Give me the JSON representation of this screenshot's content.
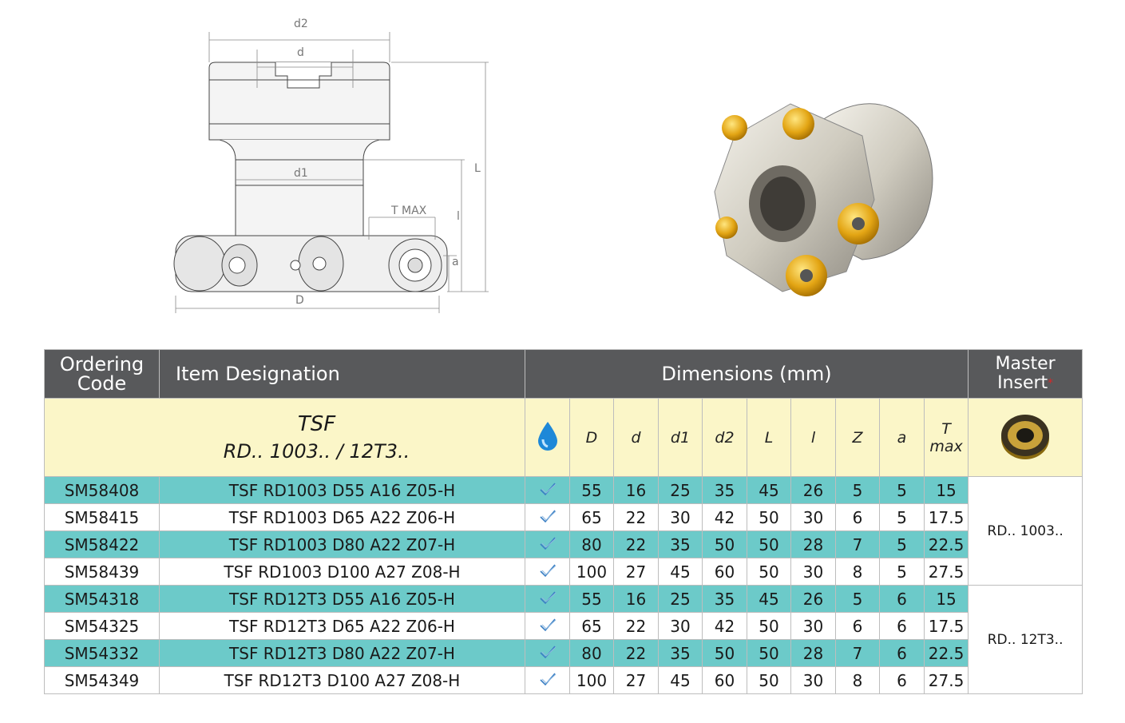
{
  "drawing": {
    "labels": {
      "d2": "d2",
      "d": "d",
      "d1": "d1",
      "tmax": "T MAX",
      "L": "L",
      "l": "l",
      "a": "a",
      "D": "D"
    }
  },
  "table": {
    "headers": {
      "ordering_code": [
        "Ordering",
        "Code"
      ],
      "item_designation": "Item Designation",
      "dimensions": "Dimensions (mm)",
      "master_insert": [
        "Master",
        "Insert"
      ],
      "master_mark": "*"
    },
    "series": {
      "name": "TSF",
      "inserts": "RD.. 1003.. / 12T3.."
    },
    "columns": [
      "D",
      "d",
      "d1",
      "d2",
      "L",
      "l",
      "Z",
      "a",
      "T",
      "max"
    ],
    "groups": [
      {
        "master": "RD.. 1003..",
        "rows": [
          {
            "code": "SM58408",
            "item": "TSF RD1003 D55 A16 Z05-H",
            "v": [
              "55",
              "16",
              "25",
              "35",
              "45",
              "26",
              "5",
              "5",
              "15"
            ]
          },
          {
            "code": "SM58415",
            "item": "TSF RD1003 D65 A22 Z06-H",
            "v": [
              "65",
              "22",
              "30",
              "42",
              "50",
              "30",
              "6",
              "5",
              "17.5"
            ]
          },
          {
            "code": "SM58422",
            "item": "TSF RD1003 D80 A22 Z07-H",
            "v": [
              "80",
              "22",
              "35",
              "50",
              "50",
              "28",
              "7",
              "5",
              "22.5"
            ]
          },
          {
            "code": "SM58439",
            "item": "TSF RD1003 D100 A27 Z08-H",
            "v": [
              "100",
              "27",
              "45",
              "60",
              "50",
              "30",
              "8",
              "5",
              "27.5"
            ]
          }
        ]
      },
      {
        "master": "RD.. 12T3..",
        "rows": [
          {
            "code": "SM54318",
            "item": "TSF RD12T3 D55 A16 Z05-H",
            "v": [
              "55",
              "16",
              "25",
              "35",
              "45",
              "26",
              "5",
              "6",
              "15"
            ]
          },
          {
            "code": "SM54325",
            "item": "TSF RD12T3 D65 A22 Z06-H",
            "v": [
              "65",
              "22",
              "30",
              "42",
              "50",
              "30",
              "6",
              "6",
              "17.5"
            ]
          },
          {
            "code": "SM54332",
            "item": "TSF RD12T3 D80 A22 Z07-H",
            "v": [
              "80",
              "22",
              "35",
              "50",
              "50",
              "28",
              "7",
              "6",
              "22.5"
            ]
          },
          {
            "code": "SM54349",
            "item": "TSF RD12T3 D100 A27 Z08-H",
            "v": [
              "100",
              "27",
              "45",
              "60",
              "50",
              "30",
              "8",
              "6",
              "27.5"
            ]
          }
        ]
      }
    ]
  },
  "colors": {
    "header_bg": "#58595b",
    "series_bg": "#fbf6c8",
    "teal_row": "#6ccac9",
    "coolant_icon": "#1e88d8",
    "check_icon": "#3a7fc4"
  },
  "icons": {
    "coolant": "water-drop-icon",
    "check": "check-icon"
  }
}
